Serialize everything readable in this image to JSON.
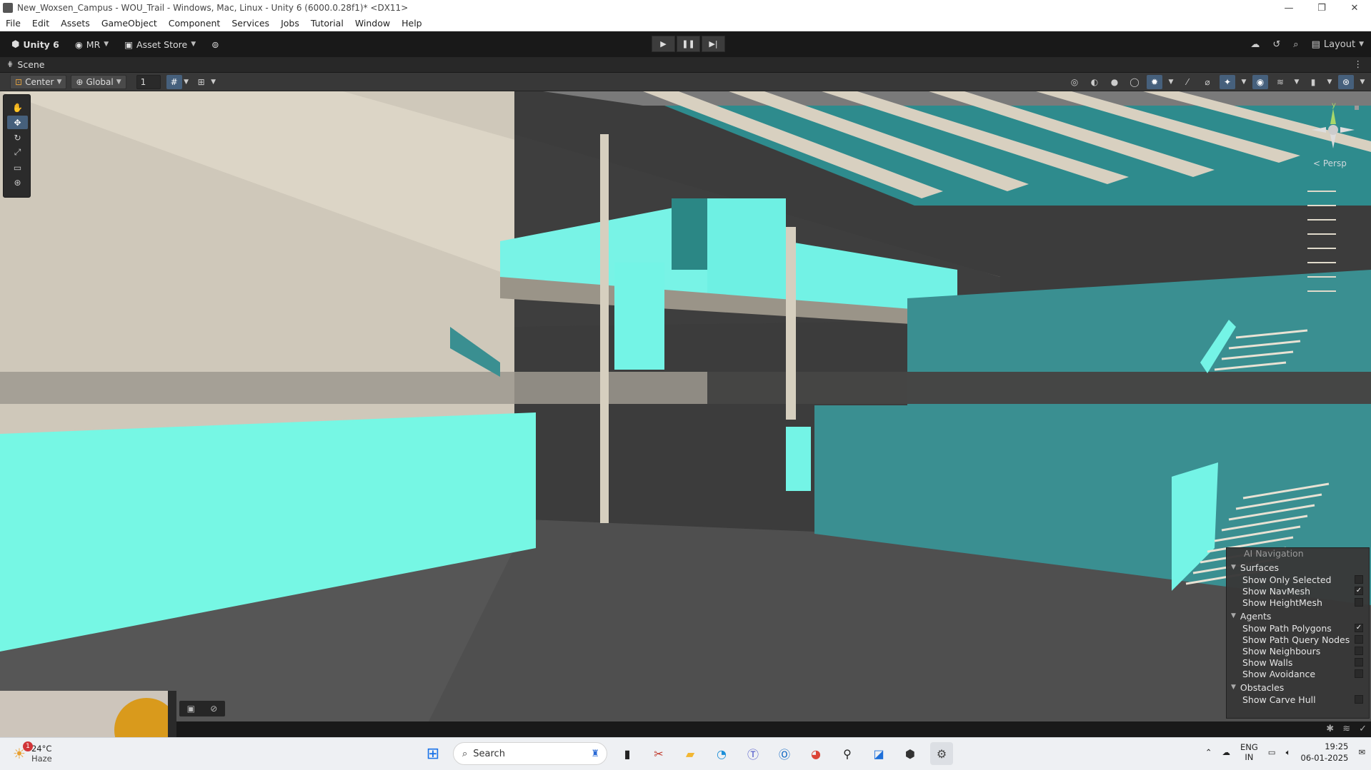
{
  "window": {
    "title": "New_Woxsen_Campus - WOU_Trail - Windows, Mac, Linux - Unity 6 (6000.0.28f1)* <DX11>",
    "controls": [
      "—",
      "❐",
      "✕"
    ]
  },
  "menu": [
    "File",
    "Edit",
    "Assets",
    "GameObject",
    "Component",
    "Services",
    "Jobs",
    "Tutorial",
    "Window",
    "Help"
  ],
  "toolbar": {
    "brand": "Unity 6",
    "account": "MR",
    "asset_store": "Asset Store",
    "layout": "Layout"
  },
  "scene": {
    "tab": "Scene",
    "pivot": "Center",
    "space": "Global",
    "grid_value": "1",
    "view_label": "< Persp"
  },
  "ai_navigation": {
    "title": "AI Navigation",
    "surfaces": {
      "label": "Surfaces",
      "items": [
        {
          "label": "Show Only Selected",
          "checked": false
        },
        {
          "label": "Show NavMesh",
          "checked": true
        },
        {
          "label": "Show HeightMesh",
          "checked": false
        }
      ]
    },
    "agents": {
      "label": "Agents",
      "items": [
        {
          "label": "Show Path Polygons",
          "checked": true
        },
        {
          "label": "Show Path Query Nodes",
          "checked": false
        },
        {
          "label": "Show Neighbours",
          "checked": false
        },
        {
          "label": "Show Walls",
          "checked": false
        },
        {
          "label": "Show Avoidance",
          "checked": false
        }
      ]
    },
    "obstacles": {
      "label": "Obstacles",
      "items": [
        {
          "label": "Show Carve Hull",
          "checked": false
        }
      ]
    }
  },
  "taskbar": {
    "weather_temp": "24°C",
    "weather_desc": "Haze",
    "weather_badge": "1",
    "search_placeholder": "Search",
    "lang_top": "ENG",
    "lang_bottom": "IN",
    "time": "19:25",
    "date": "06-01-2025"
  },
  "colors": {
    "navmesh_cyan": "#7ff9ec",
    "wall_teal": "#3b8f90",
    "floor_gray": "#555555",
    "accent_blue": "#46607c"
  }
}
